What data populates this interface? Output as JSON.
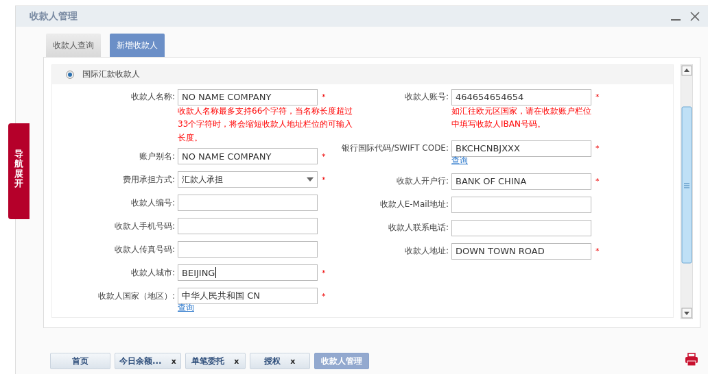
{
  "window": {
    "title": "收款人管理"
  },
  "nav_tab": {
    "label": "导航展开"
  },
  "tabs": [
    {
      "label": "收款人查询",
      "selected": false
    },
    {
      "label": "新增收款人",
      "selected": true
    }
  ],
  "payee_type": {
    "label": "国际汇款收款人",
    "selected": true
  },
  "left_column": [
    {
      "kind": "input",
      "label": "收款人名称:",
      "value": "NO NAME COMPANY",
      "required": true
    },
    {
      "kind": "hint",
      "text": "收款人名称最多支持66个字符，当名称长度超过33个字符时，将会缩短收款人地址栏位的可输入长度。"
    },
    {
      "kind": "input",
      "label": "账户别名:",
      "value": "NO NAME COMPANY",
      "required": true
    },
    {
      "kind": "select",
      "label": "费用承担方式:",
      "value": "汇款人承担",
      "required": true
    },
    {
      "kind": "input",
      "label": "收款人编号:",
      "required": false
    },
    {
      "kind": "input",
      "label": "收款人手机号码:",
      "required": false
    },
    {
      "kind": "input",
      "label": "收款人传真号码:",
      "required": false
    },
    {
      "kind": "input",
      "label": "收款人城市:",
      "value": "BEIJING",
      "required": true,
      "focused": true
    },
    {
      "kind": "input",
      "label": "收款人国家（地区）:",
      "value": "中华人民共和国 CN",
      "required": true
    },
    {
      "kind": "link",
      "text": "查询"
    }
  ],
  "right_column": [
    {
      "kind": "input",
      "label": "收款人账号:",
      "value": "464654654654",
      "required": true
    },
    {
      "kind": "hint",
      "text": "如汇往欧元区国家，请在收款账户栏位中填写收款人IBAN号码。"
    },
    {
      "kind": "input",
      "label": "银行国际代码/SWIFT CODE:",
      "value": "BKCHCNBJXXX",
      "required": true
    },
    {
      "kind": "link",
      "text": "查询"
    },
    {
      "kind": "input",
      "label": "收款人开户行:",
      "value": "BANK OF CHINA",
      "required": true
    },
    {
      "kind": "input",
      "label": "收款人E-Mail地址:",
      "required": false
    },
    {
      "kind": "input",
      "label": "收款人联系电话:",
      "required": false
    },
    {
      "kind": "input",
      "label": "收款人地址:",
      "value": "DOWN TOWN ROAD",
      "required": true
    }
  ],
  "required_mark": "*",
  "taskbar": [
    {
      "label": "首页",
      "selected": false
    },
    {
      "label": "今日余额...",
      "close": "x",
      "selected": false
    },
    {
      "label": "单笔委托",
      "close": "x",
      "selected": false
    },
    {
      "label": "授权",
      "close": "x",
      "selected": false
    },
    {
      "label": "收款人管理",
      "selected": true
    }
  ]
}
